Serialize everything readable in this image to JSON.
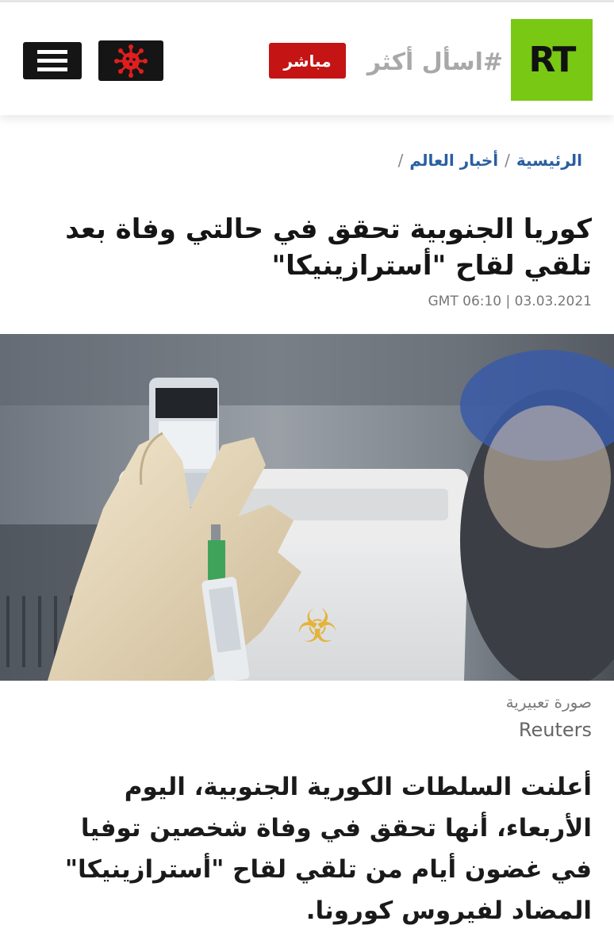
{
  "header": {
    "logo_text": "RT",
    "tagline": "#اسأل أكثر",
    "live_label": "مباشر",
    "virus_icon": "coronavirus-icon",
    "menu_icon": "hamburger-menu-icon",
    "colors": {
      "logo_bg": "#78c814",
      "live_bg": "#c41414",
      "dark_btn": "#151515",
      "virus": "#e01e1e"
    }
  },
  "breadcrumb": {
    "home": "الرئيسية",
    "section": "أخبار العالم",
    "separator": "/"
  },
  "article": {
    "title": "كوريا الجنوبية تحقق في حالتي وفاة بعد تلقي لقاح \"أسترازينيكا\"",
    "date": "GMT 06:10 | 03.03.2021",
    "image": {
      "alt": "gloved hand drawing vaccine from vial with syringe",
      "caption": "صورة تعبيرية",
      "credit": "Reuters"
    },
    "lead": "أعلنت السلطات الكورية الجنوبية، اليوم الأربعاء، أنها تحقق في وفاة شخصين توفيا في غضون أيام من تلقي لقاح \"أسترازينيكا\" المضاد لفيروس كورونا."
  }
}
